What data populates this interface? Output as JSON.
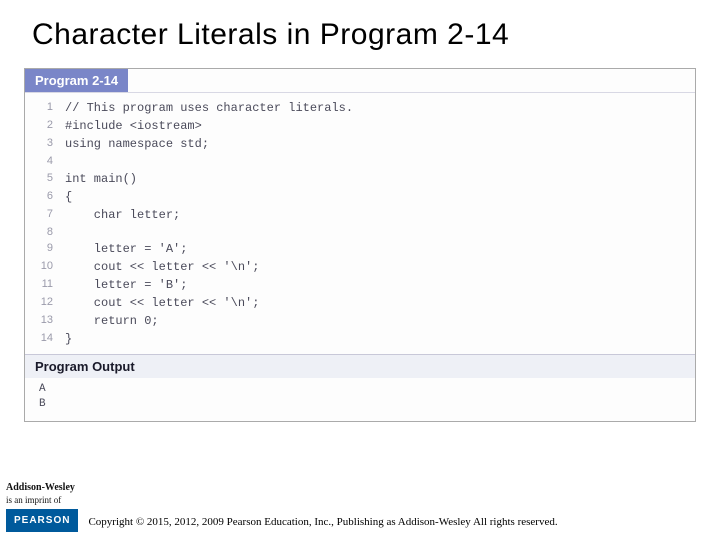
{
  "title": "Character Literals in Program 2-14",
  "program_label": "Program 2-14",
  "code": [
    {
      "n": "1",
      "t": "// This program uses character literals."
    },
    {
      "n": "2",
      "t": "#include <iostream>"
    },
    {
      "n": "3",
      "t": "using namespace std;"
    },
    {
      "n": "4",
      "t": ""
    },
    {
      "n": "5",
      "t": "int main()"
    },
    {
      "n": "6",
      "t": "{"
    },
    {
      "n": "7",
      "t": "    char letter;"
    },
    {
      "n": "8",
      "t": ""
    },
    {
      "n": "9",
      "t": "    letter = 'A';"
    },
    {
      "n": "10",
      "t": "    cout << letter << '\\n';"
    },
    {
      "n": "11",
      "t": "    letter = 'B';"
    },
    {
      "n": "12",
      "t": "    cout << letter << '\\n';"
    },
    {
      "n": "13",
      "t": "    return 0;"
    },
    {
      "n": "14",
      "t": "}"
    }
  ],
  "output_label": "Program Output",
  "output": [
    "A",
    "B"
  ],
  "logo": {
    "aw1": "Addison-Wesley",
    "aw2": "is an imprint of",
    "pearson": "PEARSON"
  },
  "copyright": "Copyright © 2015, 2012, 2009 Pearson Education, Inc., Publishing as Addison-Wesley All rights reserved."
}
